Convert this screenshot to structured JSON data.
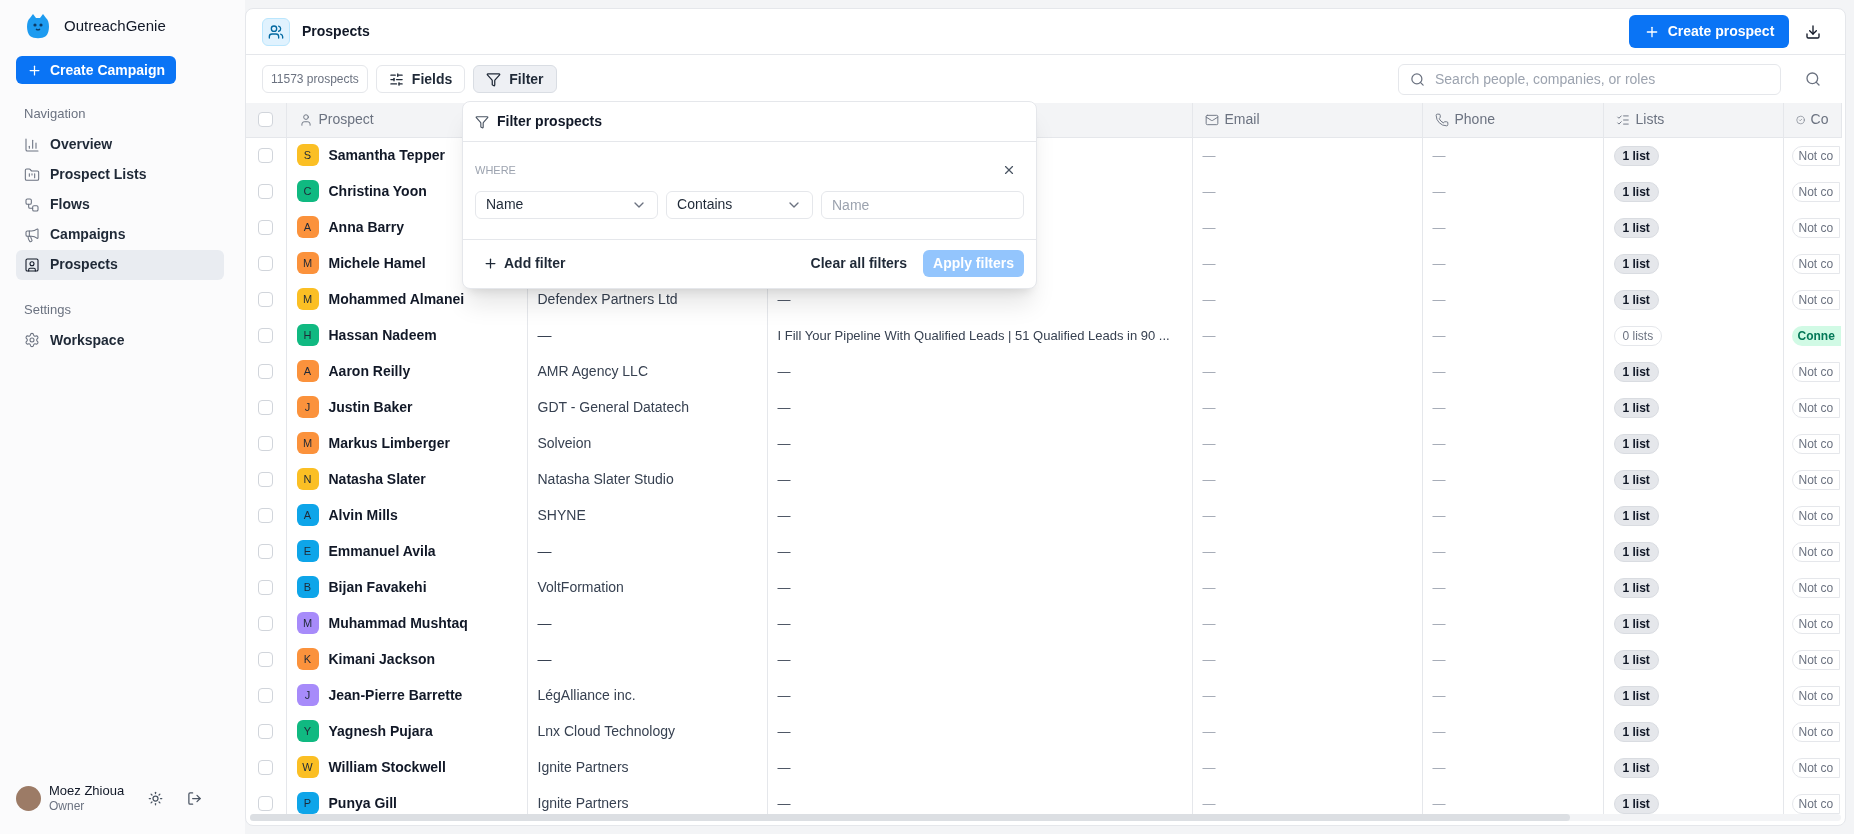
{
  "sidebar": {
    "brand": "OutreachGenie",
    "create_button": "Create Campaign",
    "sections": [
      {
        "title": "Navigation",
        "items": [
          {
            "label": "Overview",
            "kind": "chart",
            "selected": false
          },
          {
            "label": "Prospect Lists",
            "kind": "folder",
            "selected": false
          },
          {
            "label": "Flows",
            "kind": "flow",
            "selected": false
          },
          {
            "label": "Campaigns",
            "kind": "megaphone",
            "selected": false
          },
          {
            "label": "Prospects",
            "kind": "contact",
            "selected": true
          }
        ]
      },
      {
        "title": "Settings",
        "items": [
          {
            "label": "Workspace",
            "kind": "gear",
            "selected": false
          }
        ]
      }
    ],
    "user": {
      "name": "Moez Zhioua",
      "role": "Owner"
    }
  },
  "header": {
    "title": "Prospects",
    "create_button": "Create prospect"
  },
  "toolbar": {
    "count": "11573 prospects",
    "buttons": [
      {
        "label": "Fields",
        "kind": "fields",
        "selected": false
      },
      {
        "label": "Filter",
        "kind": "filter",
        "selected": true
      }
    ],
    "search": {
      "placeholder": "Search people, companies, or roles"
    }
  },
  "table": {
    "header_checkbox": {
      "checked": false
    },
    "columns": [
      {
        "kind": "prospect",
        "label": "Prospect"
      },
      {
        "kind": "blank"
      },
      {
        "kind": "blank"
      },
      {
        "kind": "email",
        "label": "Email"
      },
      {
        "kind": "phone",
        "label": "Phone"
      },
      {
        "kind": "lists",
        "label": "Lists"
      },
      {
        "kind": "status",
        "label": "Co"
      }
    ],
    "rows": [
      {
        "checked": false,
        "initial": "S",
        "color": "#fbbf24",
        "name": "Samantha Tepper",
        "email": "—",
        "phone": "—",
        "lists": {
          "text": "1 list",
          "empty": false
        },
        "status": {
          "text": "Not co",
          "connected": false
        }
      },
      {
        "checked": false,
        "initial": "C",
        "color": "#10b981",
        "name": "Christina Yoon",
        "email": "—",
        "phone": "—",
        "lists": {
          "text": "1 list",
          "empty": false
        },
        "status": {
          "text": "Not co",
          "connected": false
        }
      },
      {
        "checked": false,
        "initial": "A",
        "color": "#fb923c",
        "name": "Anna Barry",
        "email": "—",
        "phone": "—",
        "lists": {
          "text": "1 list",
          "empty": false
        },
        "status": {
          "text": "Not co",
          "connected": false
        }
      },
      {
        "checked": false,
        "initial": "M",
        "color": "#fb923c",
        "name": "Michele Hamel",
        "email": "—",
        "phone": "—",
        "lists": {
          "text": "1 list",
          "empty": false
        },
        "status": {
          "text": "Not co",
          "connected": false
        }
      },
      {
        "checked": false,
        "initial": "M",
        "color": "#fbbf24",
        "name": "Mohammed Almanei",
        "column_3": "Defendex Partners Ltd",
        "column_4": "—",
        "email": "—",
        "phone": "—",
        "lists": {
          "text": "1 list",
          "empty": false
        },
        "status": {
          "text": "Not co",
          "connected": false
        }
      },
      {
        "checked": false,
        "initial": "H",
        "color": "#10b981",
        "name": "Hassan Nadeem",
        "column_3": "—",
        "column_4": "I Fill Your Pipeline With Qualified Leads | 51 Qualified Leads in 90 ...",
        "email": "—",
        "phone": "—",
        "lists": {
          "text": "0 lists",
          "empty": true
        },
        "status": {
          "text": "Conne",
          "connected": true
        }
      },
      {
        "checked": false,
        "initial": "A",
        "color": "#fb923c",
        "name": "Aaron Reilly",
        "column_3": "AMR Agency LLC",
        "column_4": "—",
        "email": "—",
        "phone": "—",
        "lists": {
          "text": "1 list",
          "empty": false
        },
        "status": {
          "text": "Not co",
          "connected": false
        }
      },
      {
        "checked": false,
        "initial": "J",
        "color": "#fb923c",
        "name": "Justin Baker",
        "column_3": "GDT - General Datatech",
        "column_4": "—",
        "email": "—",
        "phone": "—",
        "lists": {
          "text": "1 list",
          "empty": false
        },
        "status": {
          "text": "Not co",
          "connected": false
        }
      },
      {
        "checked": false,
        "initial": "M",
        "color": "#fb923c",
        "name": "Markus Limberger",
        "column_3": "Solveion",
        "column_4": "—",
        "email": "—",
        "phone": "—",
        "lists": {
          "text": "1 list",
          "empty": false
        },
        "status": {
          "text": "Not co",
          "connected": false
        }
      },
      {
        "checked": false,
        "initial": "N",
        "color": "#fbbf24",
        "name": "Natasha Slater",
        "column_3": "Natasha Slater Studio",
        "column_4": "—",
        "email": "—",
        "phone": "—",
        "lists": {
          "text": "1 list",
          "empty": false
        },
        "status": {
          "text": "Not co",
          "connected": false
        }
      },
      {
        "checked": false,
        "initial": "A",
        "color": "#0ea5e9",
        "name": "Alvin Mills",
        "column_3": "SHYNE",
        "column_4": "—",
        "email": "—",
        "phone": "—",
        "lists": {
          "text": "1 list",
          "empty": false
        },
        "status": {
          "text": "Not co",
          "connected": false
        }
      },
      {
        "checked": false,
        "initial": "E",
        "color": "#0ea5e9",
        "name": "Emmanuel Avila",
        "column_3": "—",
        "column_4": "—",
        "email": "—",
        "phone": "—",
        "lists": {
          "text": "1 list",
          "empty": false
        },
        "status": {
          "text": "Not co",
          "connected": false
        }
      },
      {
        "checked": false,
        "initial": "B",
        "color": "#0ea5e9",
        "name": "Bijan Favakehi",
        "column_3": "VoltFormation",
        "column_4": "—",
        "email": "—",
        "phone": "—",
        "lists": {
          "text": "1 list",
          "empty": false
        },
        "status": {
          "text": "Not co",
          "connected": false
        }
      },
      {
        "checked": false,
        "initial": "M",
        "color": "#a78bfa",
        "name": "Muhammad Mushtaq",
        "column_3": "—",
        "column_4": "—",
        "email": "—",
        "phone": "—",
        "lists": {
          "text": "1 list",
          "empty": false
        },
        "status": {
          "text": "Not co",
          "connected": false
        }
      },
      {
        "checked": false,
        "initial": "K",
        "color": "#fb923c",
        "name": "Kimani Jackson",
        "column_3": "—",
        "column_4": "—",
        "email": "—",
        "phone": "—",
        "lists": {
          "text": "1 list",
          "empty": false
        },
        "status": {
          "text": "Not co",
          "connected": false
        }
      },
      {
        "checked": false,
        "initial": "J",
        "color": "#a78bfa",
        "name": "Jean-Pierre Barrette",
        "column_3": "LégAlliance inc.",
        "column_4": "—",
        "email": "—",
        "phone": "—",
        "lists": {
          "text": "1 list",
          "empty": false
        },
        "status": {
          "text": "Not co",
          "connected": false
        }
      },
      {
        "checked": false,
        "initial": "Y",
        "color": "#10b981",
        "name": "Yagnesh Pujara",
        "column_3": "Lnx Cloud Technology",
        "column_4": "—",
        "email": "—",
        "phone": "—",
        "lists": {
          "text": "1 list",
          "empty": false
        },
        "status": {
          "text": "Not co",
          "connected": false
        }
      },
      {
        "checked": false,
        "initial": "W",
        "color": "#fbbf24",
        "name": "William Stockwell",
        "column_3": "Ignite Partners",
        "column_4": "—",
        "email": "—",
        "phone": "—",
        "lists": {
          "text": "1 list",
          "empty": false
        },
        "status": {
          "text": "Not co",
          "connected": false
        }
      },
      {
        "checked": false,
        "initial": "P",
        "color": "#0ea5e9",
        "name": "Punya Gill",
        "column_3": "Ignite Partners",
        "column_4": "—",
        "email": "—",
        "phone": "—",
        "lists": {
          "text": "1 list",
          "empty": false
        },
        "status": {
          "text": "Not co",
          "connected": false
        }
      }
    ]
  },
  "filter_popup": {
    "title": "Filter prospects",
    "where_label": "WHERE",
    "field_select": "Name",
    "operator_select": "Contains",
    "value_placeholder": "Name",
    "add_button": "Add filter",
    "clear_button": "Clear all filters",
    "apply_button": {
      "label": "Apply filters",
      "disabled": true
    }
  }
}
